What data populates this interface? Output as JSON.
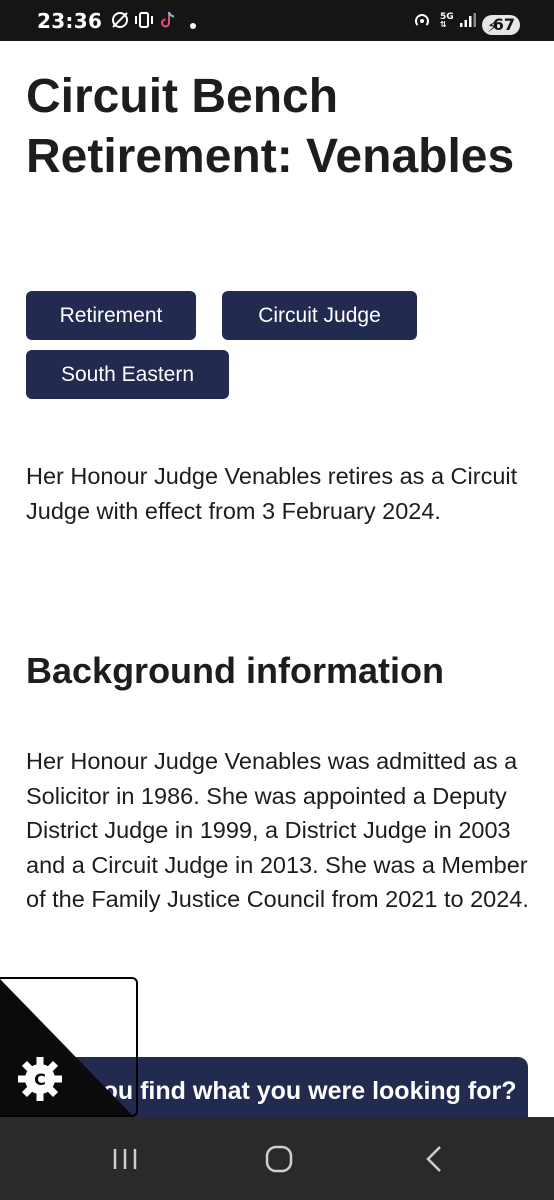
{
  "status_bar": {
    "time": "23:36",
    "network": "5G",
    "battery": "67"
  },
  "article": {
    "title": "Circuit Bench Retirement: Venables",
    "tags": [
      "Retirement",
      "Circuit Judge",
      "South Eastern"
    ],
    "intro": "Her Honour Judge Venables retires as a Circuit Judge with effect from 3 February 2024.",
    "background_heading": "Background information",
    "background_text": "Her Honour Judge Venables was admitted as a Solicitor in 1986. She was appointed a Deputy District Judge in 1999, a District Judge in 2003 and a Circuit Judge in 2013. She was a Member of the Family Justice Council from 2021 to 2024."
  },
  "feedback": {
    "prompt": "Did you find what you were looking for?"
  },
  "cookie_widget": {
    "letter": "C",
    "icon": "cookie-settings-icon"
  },
  "nav": {
    "recents_icon": "recents-icon",
    "home_icon": "home-icon",
    "back_icon": "back-icon"
  },
  "colors": {
    "brand_navy": "#232a4f",
    "status_bar": "#151515",
    "nav_bar": "#2a2a2a"
  }
}
